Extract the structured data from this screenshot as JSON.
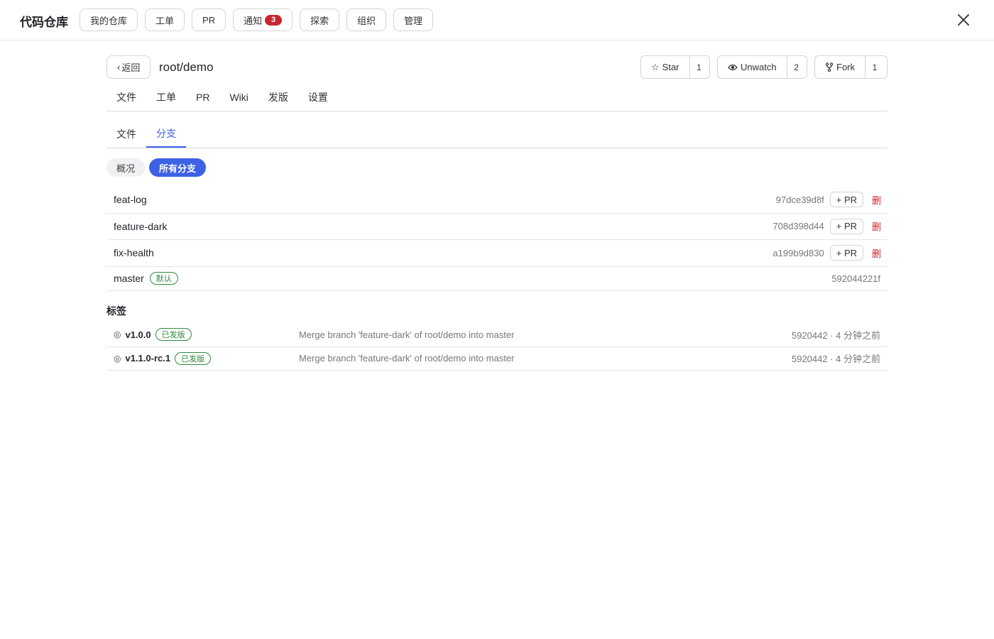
{
  "app": {
    "title": "代码仓库"
  },
  "top_nav": [
    {
      "label": "我的仓库"
    },
    {
      "label": "工单"
    },
    {
      "label": "PR"
    },
    {
      "label": "通知",
      "badge": "3"
    },
    {
      "label": "探索"
    },
    {
      "label": "组织"
    },
    {
      "label": "管理"
    }
  ],
  "repo": {
    "back_label": "返回",
    "name": "root/demo",
    "star_label": "Star",
    "star_count": "1",
    "watch_label": "Unwatch",
    "watch_count": "2",
    "fork_label": "Fork",
    "fork_count": "1"
  },
  "repo_tabs": [
    "文件",
    "工单",
    "PR",
    "Wiki",
    "发版",
    "设置"
  ],
  "sub_tabs": {
    "files": "文件",
    "branches": "分支",
    "active": "branches"
  },
  "pills": {
    "overview": "概况",
    "all_branches": "所有分支"
  },
  "branches": [
    {
      "name": "feat-log",
      "sha": "97dce39d8f",
      "pr_label": "+ PR",
      "delete_label": "删"
    },
    {
      "name": "feature-dark",
      "sha": "708d398d44",
      "pr_label": "+ PR",
      "delete_label": "删"
    },
    {
      "name": "fix-health",
      "sha": "a199b9d830",
      "pr_label": "+ PR",
      "delete_label": "删"
    },
    {
      "name": "master",
      "default_badge": "默认",
      "sha": "592044221f"
    }
  ],
  "tags_section": {
    "title": "标签"
  },
  "tags": [
    {
      "name": "v1.0.0",
      "badge": "已发版",
      "message": "Merge branch 'feature-dark' of root/demo into master",
      "meta": "5920442 · 4 分钟之前"
    },
    {
      "name": "v1.1.0-rc.1",
      "badge": "已发版",
      "message": "Merge branch 'feature-dark' of root/demo into master",
      "meta": "5920442 · 4 分钟之前"
    }
  ],
  "colors": {
    "accent": "#3d62e6",
    "danger": "#d1242f",
    "success": "#2f8a3e",
    "badge": "#c6262e"
  }
}
